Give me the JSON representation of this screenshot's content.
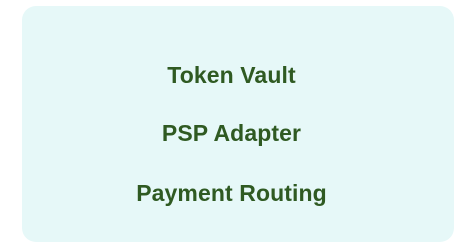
{
  "node": {
    "items": [
      {
        "label": "Token Vault"
      },
      {
        "label": "PSP Adapter"
      },
      {
        "label": "Payment Routing"
      }
    ],
    "colors": {
      "background": "#e6f8f8",
      "text": "#2f5a22"
    }
  }
}
